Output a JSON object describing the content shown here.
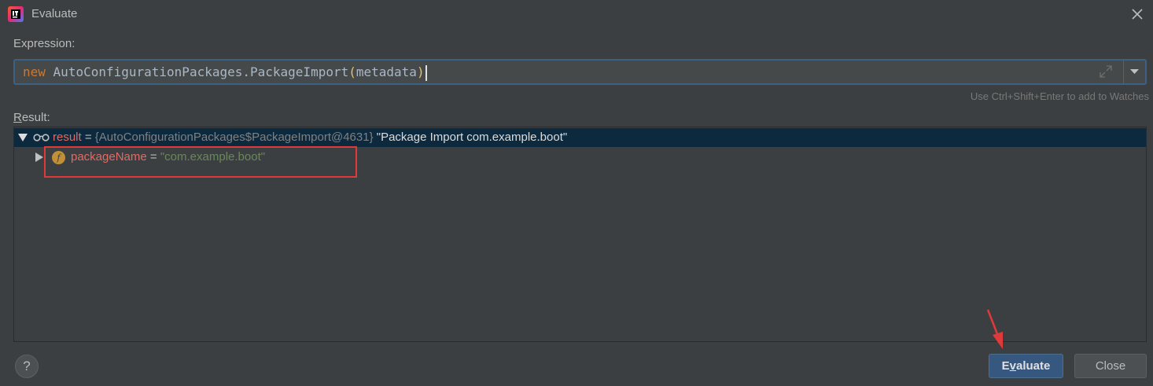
{
  "window": {
    "title": "Evaluate",
    "app_icon": "intellij-idea-icon",
    "close_icon": "close-icon"
  },
  "expression": {
    "label": "Expression:",
    "keyword": "new",
    "class_call": "AutoConfigurationPackages.PackageImport",
    "open_paren": "(",
    "argument": "metadata",
    "close_paren": ")",
    "hint": "Use Ctrl+Shift+Enter to add to Watches"
  },
  "result": {
    "label_first": "R",
    "label_rest": "esult:",
    "rows": [
      {
        "name": "result",
        "eq": " = ",
        "type": "{AutoConfigurationPackages$PackageImport@4631}",
        "value": " \"Package Import com.example.boot\"",
        "icon": "watch-glasses-icon",
        "expanded": true
      },
      {
        "field_badge": "f",
        "name": "packageName",
        "eq": " = ",
        "value": "\"com.example.boot\"",
        "icon": "field-icon",
        "expanded": false
      }
    ]
  },
  "buttons": {
    "help": "?",
    "evaluate_before": "E",
    "evaluate_mnemonic": "v",
    "evaluate_after": "aluate",
    "close": "Close"
  },
  "colors": {
    "background": "#3c3f41",
    "accent": "#365880",
    "annotation_red": "#e0393a",
    "keyword": "#cc7832",
    "string_green": "#6a8759"
  }
}
